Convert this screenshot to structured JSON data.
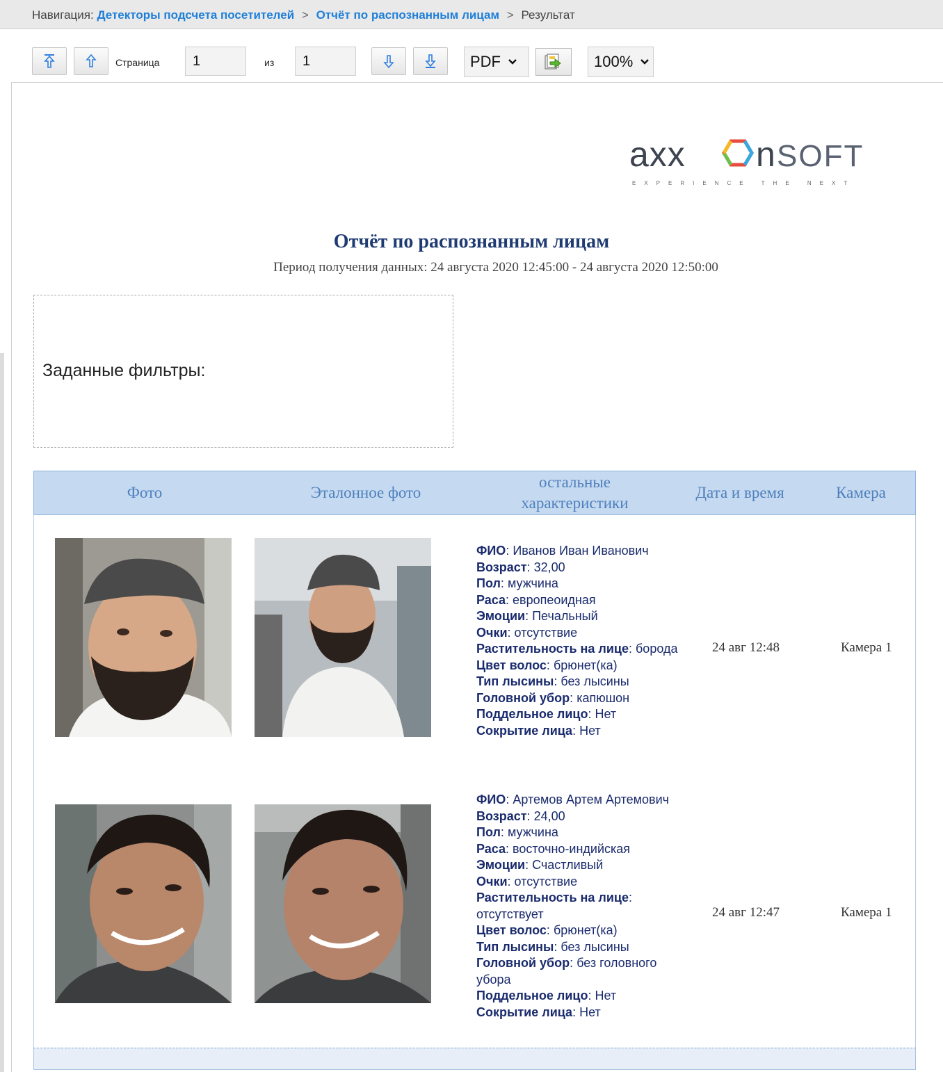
{
  "breadcrumb": {
    "prefix": "Навигация:",
    "item1": "Детекторы подсчета посетителей",
    "item2": "Отчёт по распознанным лицам",
    "current": "Результат",
    "separator": ">"
  },
  "toolbar": {
    "first_icon": "first-page-icon",
    "prev_icon": "prev-page-icon",
    "page_label": "Страница",
    "page_value": "1",
    "of_label": "из",
    "total_value": "1",
    "next_icon": "next-page-icon",
    "last_icon": "last-page-icon",
    "format_value": "PDF",
    "export_icon": "export-icon",
    "zoom_value": "100%"
  },
  "logo": {
    "brand": "axxonsoft",
    "tagline": "EXPERIENCE THE NEXT"
  },
  "report": {
    "title": "Отчёт по распознанным лицам",
    "period": "Период получения данных: 24 августа 2020 12:45:00 - 24 августа 2020 12:50:00",
    "filters_label": "Заданные фильтры:"
  },
  "table": {
    "headers": [
      "Фото",
      "Эталонное фото",
      "остальные характеристики",
      "Дата и время",
      "Камера"
    ],
    "rows": [
      {
        "attrs": [
          {
            "k": "ФИО",
            "v": "Иванов Иван Иванович"
          },
          {
            "k": "Возраст",
            "v": "32,00"
          },
          {
            "k": "Пол",
            "v": "мужчина"
          },
          {
            "k": "Раса",
            "v": "европеоидная"
          },
          {
            "k": "Эмоции",
            "v": "Печальный"
          },
          {
            "k": "Очки",
            "v": "отсутствие"
          },
          {
            "k": "Растительность на лице",
            "v": "борода"
          },
          {
            "k": "Цвет волос",
            "v": "брюнет(ка)"
          },
          {
            "k": "Тип лысины",
            "v": "без лысины"
          },
          {
            "k": "Головной убор",
            "v": "капюшон"
          },
          {
            "k": "Поддельное лицо",
            "v": "Нет"
          },
          {
            "k": "Сокрытие лица",
            "v": "Нет"
          }
        ],
        "datetime": "24 авг 12:48",
        "camera": "Камера 1"
      },
      {
        "attrs": [
          {
            "k": "ФИО",
            "v": "Артемов Артем Артемович"
          },
          {
            "k": "Возраст",
            "v": "24,00"
          },
          {
            "k": "Пол",
            "v": "мужчина"
          },
          {
            "k": "Раса",
            "v": "восточно-индийская"
          },
          {
            "k": "Эмоции",
            "v": "Счастливый"
          },
          {
            "k": "Очки",
            "v": "отсутствие"
          },
          {
            "k": "Растительность на лице",
            "v": "отсутствует"
          },
          {
            "k": "Цвет волос",
            "v": "брюнет(ка)"
          },
          {
            "k": "Тип лысины",
            "v": "без лысины"
          },
          {
            "k": "Головной убор",
            "v": "без головного убора"
          },
          {
            "k": "Поддельное лицо",
            "v": "Нет"
          },
          {
            "k": "Сокрытие лица",
            "v": "Нет"
          }
        ],
        "datetime": "24 авг 12:47",
        "camera": "Камера 1"
      }
    ]
  },
  "colors": {
    "link": "#1f7fd8",
    "header_bg": "#c5daf0",
    "header_text": "#4f7fbd",
    "title": "#1f3b73",
    "attr_text": "#1a2b6d"
  }
}
